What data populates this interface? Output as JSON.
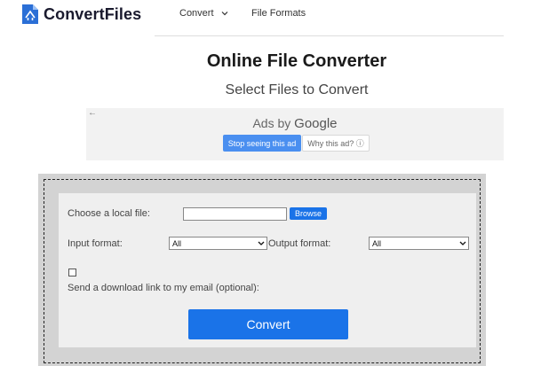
{
  "header": {
    "brand": "ConvertFiles",
    "nav": {
      "convert_label": "Convert",
      "file_formats_label": "File Formats"
    }
  },
  "main": {
    "title": "Online File Converter",
    "subtitle": "Select Files to Convert"
  },
  "ad": {
    "ads_by": "Ads by",
    "google": "Google",
    "stop_label": "Stop seeing this ad",
    "why_label": "Why this ad? ⓘ"
  },
  "converter": {
    "choose_label": "Choose a local file:",
    "browse_label": "Browse",
    "input_format_label": "Input format:",
    "input_format_value": "All",
    "output_format_label": "Output format:",
    "output_format_value": "All",
    "email_label": "Send a download link to my email (optional):",
    "convert_label": "Convert"
  },
  "colors": {
    "accent": "#1a73e8",
    "ad_button": "#4a8ff0",
    "panel_bg": "#d3d3d3",
    "inner_bg": "#efefef"
  }
}
